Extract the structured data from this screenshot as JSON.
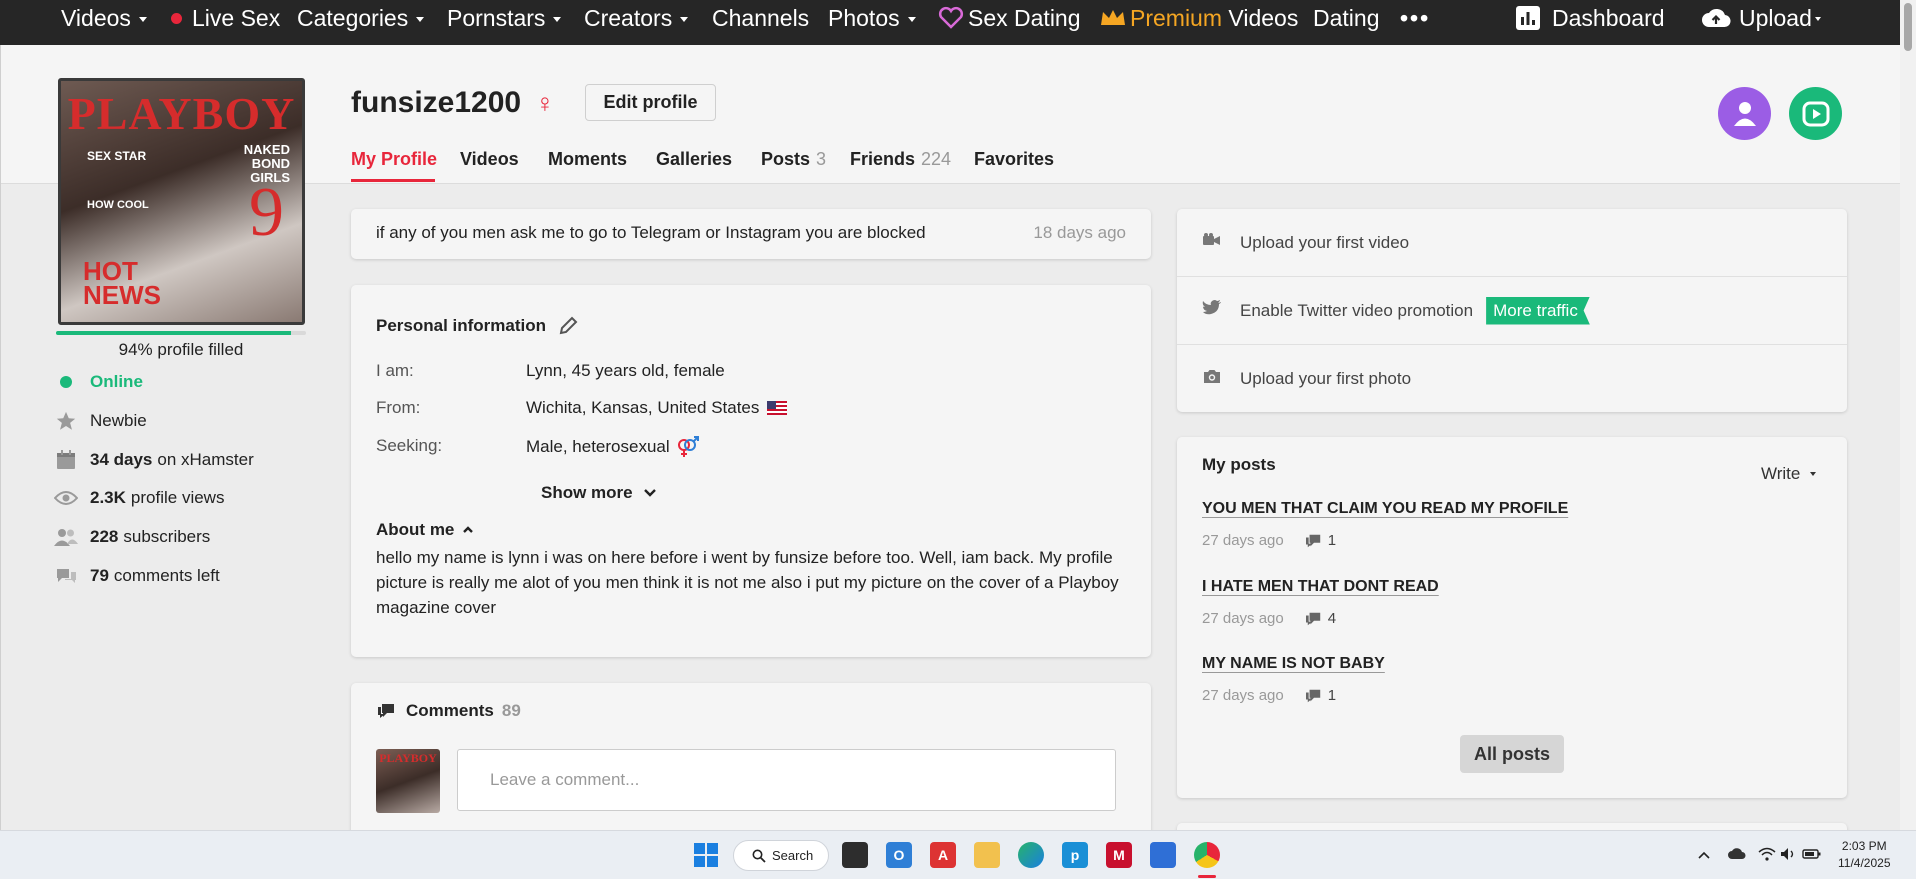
{
  "nav": {
    "videos": "Videos",
    "live_sex": "Live Sex",
    "categories": "Categories",
    "pornstars": "Pornstars",
    "creators": "Creators",
    "channels": "Channels",
    "photos": "Photos",
    "sex_dating": "Sex Dating",
    "premium_word": "Premium",
    "premium_rest": " Videos",
    "dating": "Dating",
    "more": "•••",
    "dashboard": "Dashboard",
    "upload": "Upload"
  },
  "profile": {
    "username": "funsize1200",
    "gender_symbol": "♀",
    "edit_label": "Edit profile",
    "avatar_logo": "PLAYBOY",
    "progress_fraction": 0.94,
    "filled_text": "94% profile filled"
  },
  "stats": {
    "online": "Online",
    "newbie": "Newbie",
    "days_value": "34 days",
    "days_label": "on xHamster",
    "views_value": "2.3K",
    "views_label": "profile views",
    "subs_value": "228",
    "subs_label": "subscribers",
    "comments_value": "79",
    "comments_label": "comments left"
  },
  "tabs": [
    {
      "label": "My Profile",
      "count": ""
    },
    {
      "label": "Videos",
      "count": ""
    },
    {
      "label": "Moments",
      "count": ""
    },
    {
      "label": "Galleries",
      "count": ""
    },
    {
      "label": "Posts",
      "count": "3"
    },
    {
      "label": "Friends",
      "count": "224"
    },
    {
      "label": "Favorites",
      "count": ""
    }
  ],
  "status": {
    "text": "if any of you men ask me to go to Telegram or Instagram you are blocked",
    "ago": "18 days ago"
  },
  "personal": {
    "title": "Personal information",
    "iam_label": "I am:",
    "iam_value": "Lynn, 45 years old, female",
    "from_label": "From:",
    "from_value": "Wichita, Kansas, United States",
    "seeking_label": "Seeking:",
    "seeking_value": "Male, heterosexual",
    "show_more": "Show more",
    "about_title": "About me",
    "about_text": "hello my name is lynn i was on here before i went by funsize before too. Well, iam back. My profile picture is really me alot of you men think it is not me also i put my picture on the cover of a Playboy magazine cover"
  },
  "comments": {
    "title": "Comments",
    "count": "89",
    "placeholder": "Leave a comment..."
  },
  "todo": {
    "upload_video": "Upload your first video",
    "twitter": "Enable Twitter video promotion",
    "more_traffic": "More traffic",
    "upload_photo": "Upload your first photo"
  },
  "posts": {
    "title": "My posts",
    "write": "Write",
    "items": [
      {
        "title": "YOU MEN THAT CLAIM YOU READ MY PROFILE",
        "ago": "27 days ago",
        "comments": "1"
      },
      {
        "title": "I HATE MEN THAT DONT READ",
        "ago": "27 days ago",
        "comments": "4"
      },
      {
        "title": "MY NAME IS NOT BABY",
        "ago": "27 days ago",
        "comments": "1"
      }
    ],
    "all_posts": "All posts"
  },
  "taskbar": {
    "search": "Search",
    "time": "2:03 PM",
    "date": "11/4/2025"
  },
  "colors": {
    "accent_red": "#e8263b",
    "accent_green": "#1ab97a",
    "premium_gold": "#f5a623",
    "avatar_purple": "#9b5de5"
  }
}
